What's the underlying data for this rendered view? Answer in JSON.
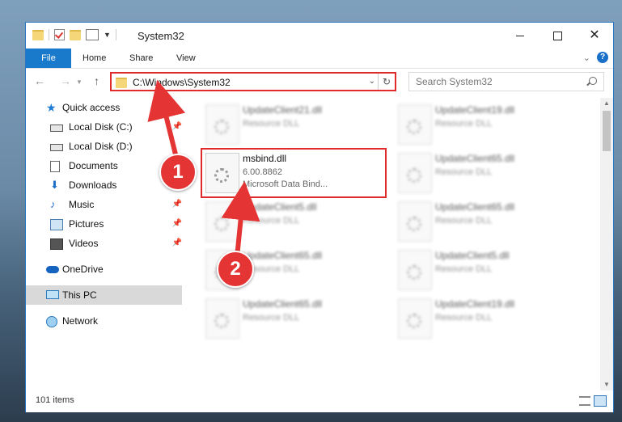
{
  "window": {
    "title": "System32"
  },
  "ribbon": {
    "tabs": [
      "File",
      "Home",
      "Share",
      "View"
    ]
  },
  "address": {
    "path": "C:\\Windows\\System32"
  },
  "search": {
    "placeholder": "Search System32"
  },
  "sidebar": {
    "items": [
      {
        "label": "Quick access",
        "icon": "star-icon"
      },
      {
        "label": "Local Disk (C:)",
        "icon": "drive-icon",
        "pinned": true
      },
      {
        "label": "Local Disk (D:)",
        "icon": "drive-icon"
      },
      {
        "label": "Documents",
        "icon": "document-icon",
        "pinned": true
      },
      {
        "label": "Downloads",
        "icon": "download-icon",
        "pinned": true
      },
      {
        "label": "Music",
        "icon": "music-icon",
        "pinned": true
      },
      {
        "label": "Pictures",
        "icon": "picture-icon",
        "pinned": true
      },
      {
        "label": "Videos",
        "icon": "video-icon",
        "pinned": true
      },
      {
        "label": "OneDrive",
        "icon": "cloud-icon"
      },
      {
        "label": "This PC",
        "icon": "computer-icon",
        "selected": true
      },
      {
        "label": "Network",
        "icon": "network-icon"
      }
    ]
  },
  "files": [
    {
      "name": "UpdateClient21.dll",
      "type": "Resource DLL"
    },
    {
      "name": "UpdateClient19.dll",
      "type": "Resource DLL"
    },
    {
      "name": "msbind.dll",
      "version": "6.00.8862",
      "description": "Microsoft Data Bind...",
      "highlighted": true
    },
    {
      "name": "UpdateClient65.dll",
      "type": "Resource DLL"
    },
    {
      "name": "UpdateClient5.dll",
      "type": "Resource DLL"
    },
    {
      "name": "UpdateClient65.dll",
      "type": "Resource DLL"
    },
    {
      "name": "UpdateClient65.dll",
      "type": "Resource DLL"
    },
    {
      "name": "UpdateClient5.dll",
      "type": "Resource DLL"
    },
    {
      "name": "UpdateClient65.dll",
      "type": "Resource DLL"
    },
    {
      "name": "UpdateClient19.dll",
      "type": "Resource DLL"
    }
  ],
  "status": {
    "item_count": "101 items"
  },
  "annotations": {
    "step1": "1",
    "step2": "2",
    "accent_color": "#e02b2b"
  }
}
